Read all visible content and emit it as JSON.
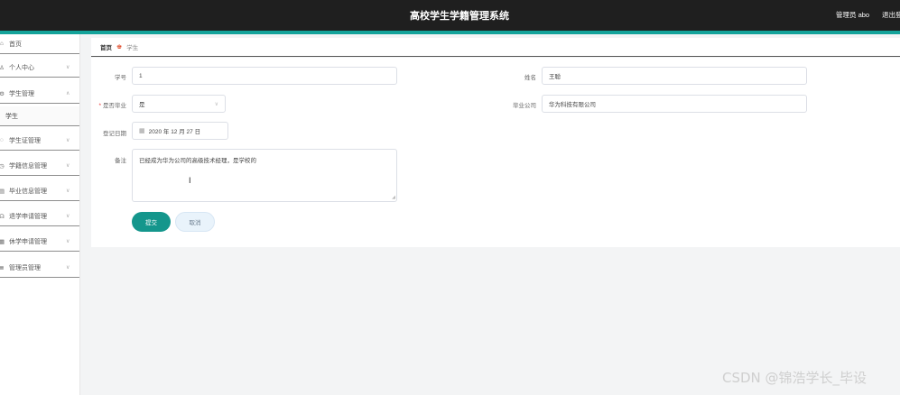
{
  "header": {
    "app_title": "高校学生学籍管理系统",
    "admin_label": "管理员 abo",
    "logout_label": "退出登"
  },
  "sidebar": {
    "items": [
      {
        "label": "首页",
        "icon": "home-icon",
        "glyph": "⌂"
      },
      {
        "label": "个人中心",
        "icon": "user-icon",
        "glyph": "♙"
      },
      {
        "label": "学生管理",
        "icon": "settings-icon",
        "glyph": "⚙"
      },
      {
        "label": "学生证管理",
        "icon": "bulb-icon",
        "glyph": "◌"
      },
      {
        "label": "学籍信息管理",
        "icon": "clock-icon",
        "glyph": "◷"
      },
      {
        "label": "毕业信息管理",
        "icon": "doc-icon",
        "glyph": "▤"
      },
      {
        "label": "退学申请管理",
        "icon": "user-check-icon",
        "glyph": "☊"
      },
      {
        "label": "休学申请管理",
        "icon": "calendar-icon",
        "glyph": "▦"
      },
      {
        "label": "管理员管理",
        "icon": "list-icon",
        "glyph": "≣"
      }
    ],
    "submenu": {
      "label": "学生"
    }
  },
  "breadcrumb": {
    "home": "首页",
    "current": "学生"
  },
  "form": {
    "student_id": {
      "label": "学号",
      "value": "1"
    },
    "name": {
      "label": "姓名",
      "value": "王聪"
    },
    "graduated": {
      "label": "是否毕业",
      "value": "是"
    },
    "company": {
      "label": "毕业公司",
      "value": "华为科技有限公司"
    },
    "register_date": {
      "label": "登记日期",
      "value": "2020 年 12 月 27 日"
    },
    "remark": {
      "label": "备注",
      "value": "已经成为华为公司的高级技术经理，是学校的"
    },
    "submit_label": "提交",
    "cancel_label": "取消"
  },
  "watermark": "CSDN @锦浩学长_毕设",
  "colors": {
    "topbar": "#1f1f1f",
    "accent": "#14a39a",
    "submit": "#14968c"
  }
}
